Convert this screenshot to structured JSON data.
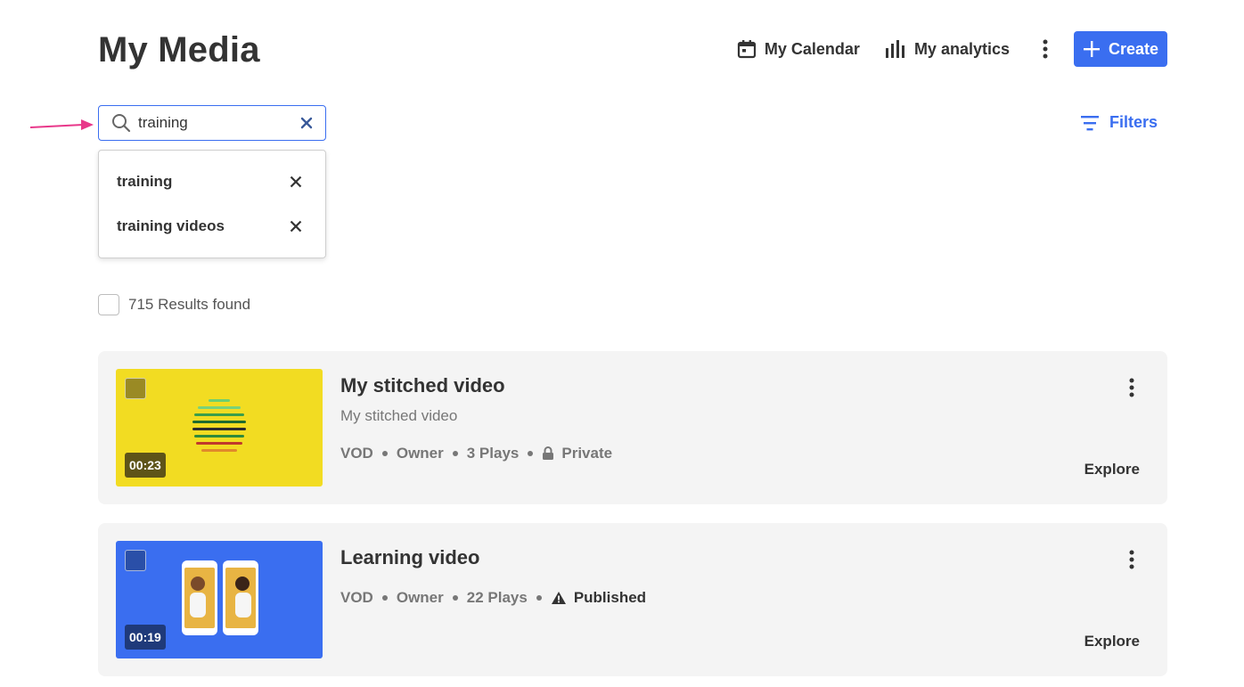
{
  "header": {
    "title": "My Media",
    "calendar_label": "My Calendar",
    "analytics_label": "My analytics",
    "create_label": "Create"
  },
  "search": {
    "value": "training",
    "suggestions": [
      {
        "label": "training"
      },
      {
        "label": "training videos"
      }
    ]
  },
  "filters_label": "Filters",
  "results_text": "715 Results found",
  "entries": [
    {
      "title": "My stitched video",
      "description": "My stitched video",
      "duration": "00:23",
      "type": "VOD",
      "role": "Owner",
      "plays": "3 Plays",
      "status": "Private",
      "status_icon": "lock-icon",
      "explore_label": "Explore",
      "thumb_color": "#f2dc22"
    },
    {
      "title": "Learning video",
      "duration": "00:19",
      "type": "VOD",
      "role": "Owner",
      "plays": "22 Plays",
      "status": "Published",
      "status_icon": "warning-icon",
      "explore_label": "Explore",
      "thumb_color": "#3a6ef0"
    }
  ],
  "colors": {
    "accent": "#3a6ef0",
    "text": "#333333",
    "muted": "#777777",
    "card_bg": "#f4f4f4",
    "arrow": "#e8388a"
  }
}
